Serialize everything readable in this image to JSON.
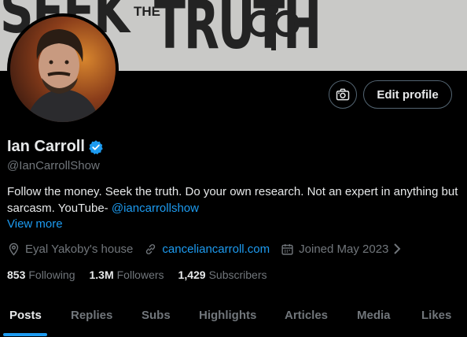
{
  "banner": {
    "text_seek": "SEEK",
    "text_the": "THE",
    "text_truth": "TRUTH"
  },
  "header": {
    "edit_profile_label": "Edit profile"
  },
  "profile": {
    "name": "Ian Carroll",
    "handle": "@IanCarrollShow",
    "bio_text": "Follow the money. Seek the truth. Do your own research. Not an expert in anything but sarcasm. YouTube- ",
    "bio_link": "@iancarrollshow",
    "view_more": "View more",
    "location": "Eyal Yakoby's house",
    "website": "canceliancarroll.com",
    "joined": "Joined May 2023"
  },
  "stats": {
    "following_count": "853",
    "following_label": "Following",
    "followers_count": "1.3M",
    "followers_label": "Followers",
    "subscribers_count": "1,429",
    "subscribers_label": "Subscribers"
  },
  "tabs": [
    {
      "label": "Posts",
      "active": true
    },
    {
      "label": "Replies"
    },
    {
      "label": "Subs"
    },
    {
      "label": "Highlights"
    },
    {
      "label": "Articles"
    },
    {
      "label": "Media"
    },
    {
      "label": "Likes"
    }
  ],
  "colors": {
    "accent": "#1d9bf0",
    "background": "#000000",
    "secondary_text": "#71767b"
  }
}
